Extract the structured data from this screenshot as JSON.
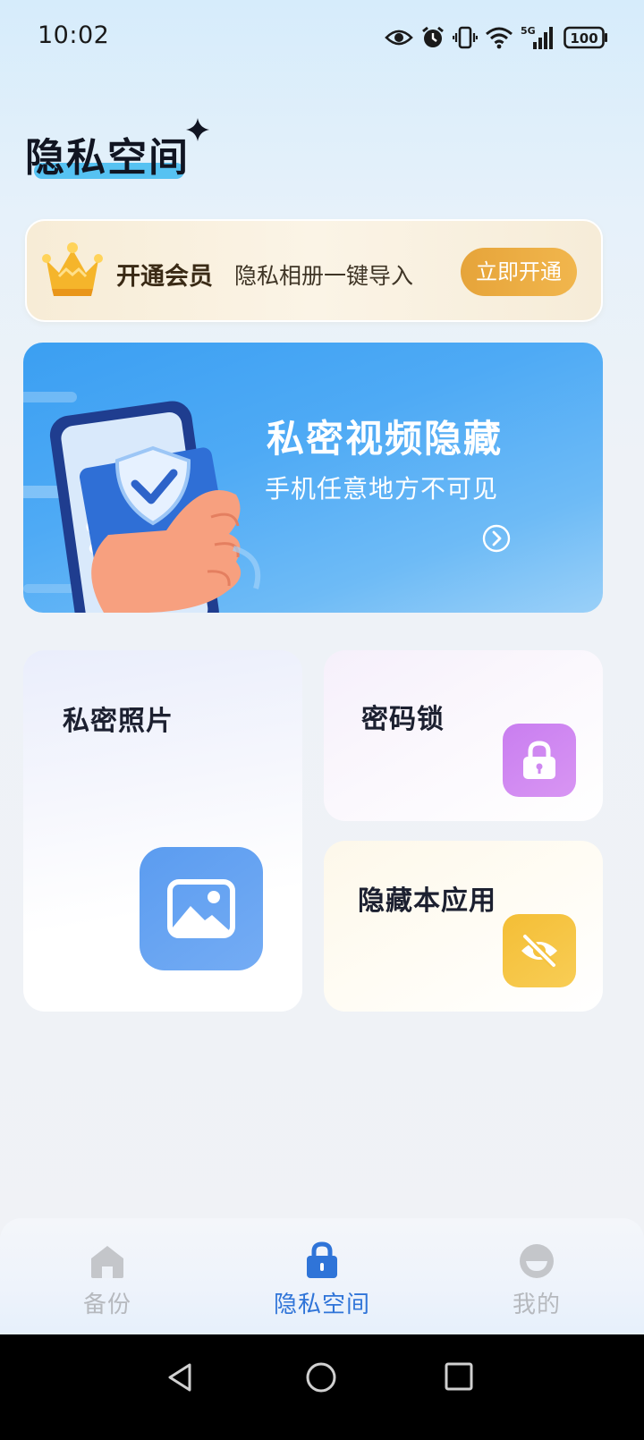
{
  "status_bar": {
    "time": "10:02",
    "icons": [
      "eye-icon",
      "alarm-icon",
      "vibrate-icon",
      "wifi-icon",
      "signal-5g-icon",
      "battery-icon"
    ],
    "network": "5G",
    "battery": "100"
  },
  "page": {
    "title": "隐私空间"
  },
  "vip": {
    "title": "开通会员",
    "subtitle": "隐私相册一键导入",
    "button": "立即开通"
  },
  "banner": {
    "title": "私密视频隐藏",
    "subtitle": "手机任意地方不可见"
  },
  "tiles": {
    "photos": "私密照片",
    "lock": "密码锁",
    "hide_app": "隐藏本应用"
  },
  "tab_bar": {
    "items": [
      {
        "label": "备份",
        "icon": "home-icon",
        "active": false
      },
      {
        "label": "隐私空间",
        "icon": "lock-icon",
        "active": true
      },
      {
        "label": "我的",
        "icon": "profile-icon",
        "active": false
      }
    ]
  },
  "colors": {
    "accent": "#2f74d8",
    "vip_button": "#eba840",
    "banner": "#3b9ff2",
    "lock_tile_icon": "#cf88f1",
    "hide_tile_icon": "#f5c23e"
  }
}
